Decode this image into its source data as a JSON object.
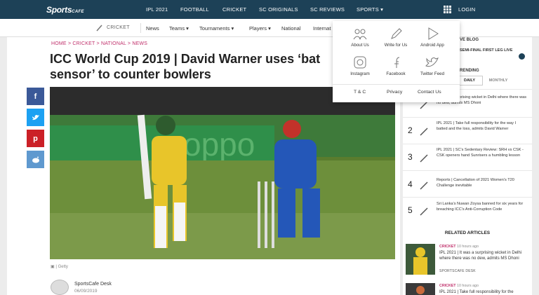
{
  "topnav": {
    "logo_main": "Sports",
    "logo_sub": "CAFE",
    "items": [
      "IPL 2021",
      "FOOTBALL",
      "CRICKET",
      "SC ORIGINALS",
      "SC REVIEWS",
      "SPORTS ▾"
    ],
    "login": "LOGIN"
  },
  "subnav": {
    "section": "CRICKET",
    "items": [
      "News",
      "Teams ▾",
      "Tournaments ▾",
      "Players ▾",
      "National",
      "Internat"
    ]
  },
  "breadcrumb": "HOME > CRICKET > NATIONAL > NEWS",
  "headline": "ICC World Cup 2019 | David Warner uses ‘bat sensor’ to counter bowlers",
  "share": [
    {
      "name": "facebook",
      "glyph": "f",
      "color": "#3b5998"
    },
    {
      "name": "twitter",
      "glyph": "t",
      "color": "#1da1f2"
    },
    {
      "name": "pinterest",
      "glyph": "p",
      "color": "#cb2027"
    },
    {
      "name": "reddit",
      "glyph": "r",
      "color": "#5f99cf"
    }
  ],
  "photo_credit": "Getty",
  "author": {
    "name": "SportsCafe Desk",
    "date": "06/09/2019"
  },
  "dropdown": {
    "items": [
      {
        "label": "About Us",
        "icon": "people-icon"
      },
      {
        "label": "Write for Us",
        "icon": "pencil-icon"
      },
      {
        "label": "Android App",
        "icon": "play-store-icon"
      },
      {
        "label": "Instagram",
        "icon": "instagram-icon"
      },
      {
        "label": "Facebook",
        "icon": "facebook-icon"
      },
      {
        "label": "Twitter Feed",
        "icon": "twitter-icon"
      }
    ],
    "footer": [
      "T & C",
      "Privacy",
      "Contact Us"
    ]
  },
  "sidebar": {
    "live_blog": "VE BLOG",
    "live_item": "SEMI-FINAL FIRST LEG LIVE",
    "trending": "RENDING",
    "tabs": {
      "daily": "DAILY",
      "monthly": "MONTHLY"
    },
    "trending_items": [
      {
        "num": "",
        "text": "...t was a surprising wicket in Delhi where there was no dew, admits MS Dhoni"
      },
      {
        "num": "2",
        "text": "IPL 2021 | Take full responsibility for the way I batted and the loss, admits David Warner"
      },
      {
        "num": "3",
        "text": "IPL 2021 | SC's Sedentary Review: SRH vs CSK - CSK openers hand Sunrisers a humbling lesson"
      },
      {
        "num": "4",
        "text": "Reports | Cancellation of 2021 Women's T20 Challenge inevitable"
      },
      {
        "num": "5",
        "text": "Sri Lanka's Nuwan Zoysa banned for six years for breaching ICC's Anti-Corruption Code"
      }
    ],
    "related_title": "RELATED ARTICLES",
    "related": [
      {
        "tag": "CRICKET",
        "time": "10 hours ago",
        "text": "IPL 2021 | It was a surprising wicket in Delhi where there was no dew, admits MS Dhoni",
        "author": "SPORTSCAFE DESK"
      },
      {
        "tag": "CRICKET",
        "time": "10 hours ago",
        "text": "IPL 2021 | Take full responsibility for the",
        "author": ""
      }
    ]
  },
  "colors": {
    "nav": "#1d4157",
    "accent": "#c0306b",
    "tag": "#c0306b"
  }
}
